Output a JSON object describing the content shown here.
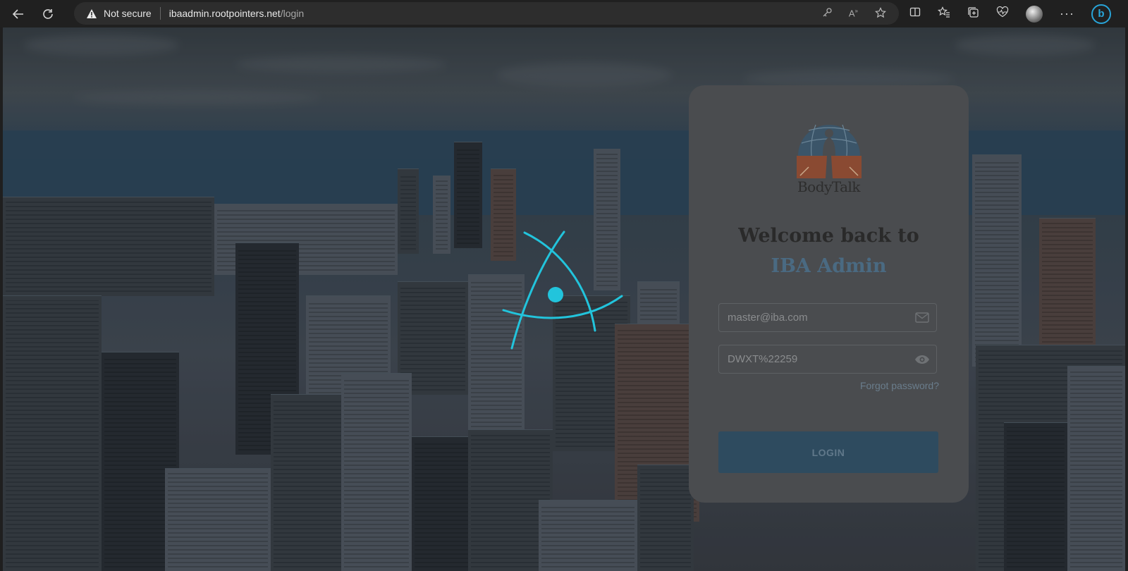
{
  "browser": {
    "security_label": "Not secure",
    "url_host": "ibaadmin.rootpointers.net",
    "url_path": "/login",
    "bing_label": "b"
  },
  "login": {
    "brand": "BodyTalk",
    "welcome": "Welcome back to",
    "app_name": "IBA Admin",
    "email_value": "master@iba.com",
    "password_value": "DWXT%22259",
    "forgot": "Forgot password?",
    "button": "LOGIN"
  },
  "colors": {
    "accent": "#2e4b5f",
    "spinner": "#22c4dc",
    "app_name": "#4a6a82"
  }
}
